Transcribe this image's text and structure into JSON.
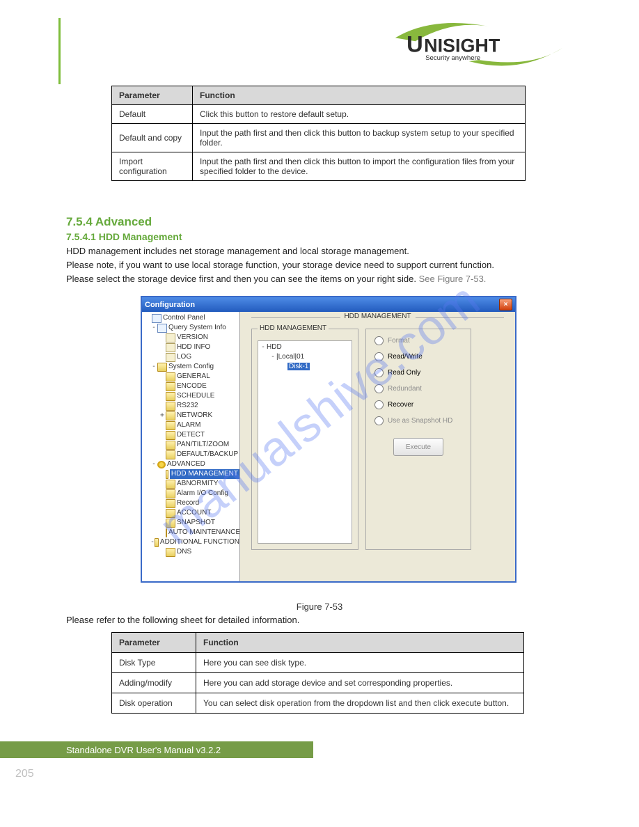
{
  "logo": {
    "brand": "UNISIGHT",
    "tagline": "Security anywhere"
  },
  "table1": {
    "h1": "Parameter",
    "h2": "Function",
    "rows": [
      {
        "p": "Default",
        "f": "Click this button to restore default setup."
      },
      {
        "p": "Default and copy",
        "f": "Input the path first and then click this button to backup system setup to your specified folder."
      },
      {
        "p": "Import configuration",
        "f": "Input the path first and then click this button to import the configuration files from your specified folder to the device."
      }
    ]
  },
  "section_heading": "7.5.4 Advanced",
  "subhead": "7.5.4.1 HDD Management",
  "lead_in": "HDD management includes net storage management and local storage management.",
  "note": "Please note, if you want to use local storage function, your storage device need to support current function.",
  "select_text_a": "Please select the storage device first and then you can see the items on your right side.",
  "select_text_b": "See Figure 7-53.",
  "watermark": "manualshive.com",
  "figure": {
    "title": "Configuration",
    "root": "Control Panel",
    "panel_label": "HDD MANAGEMENT",
    "tree": {
      "query": "Query System Info",
      "version": "VERSION",
      "hdd_info": "HDD INFO",
      "log": "LOG",
      "sysconfig": "System Config",
      "general": "GENERAL",
      "encode": "ENCODE",
      "schedule": "SCHEDULE",
      "rs232": "RS232",
      "network": "NETWORK",
      "alarm": "ALARM",
      "detect": "DETECT",
      "ptz": "PAN/TILT/ZOOM",
      "default": "DEFAULT/BACKUP",
      "advanced": "ADVANCED",
      "hdd_mgmt": "HDD MANAGEMENT",
      "abnormity": "ABNORMITY",
      "alarm_io": "Alarm I/O Config",
      "record": "Record",
      "account": "ACCOUNT",
      "snapshot": "SNAPSHOT",
      "auto_maint": "AUTO MAINTENANCE",
      "addfunc": "ADDITIONAL FUNCTION",
      "dns": "DNS"
    },
    "hdd_group_label": "HDD MANAGEMENT",
    "hdd_tree": {
      "root": "HDD",
      "local": "|Local|01",
      "disk": "Disk-1"
    },
    "options": {
      "format": "Format",
      "read_write": "Read/Write",
      "read_only": "Read Only",
      "redundant": "Redundant",
      "recover": "Recover",
      "snapshot_hd": "Use as Snapshot HD"
    },
    "execute": "Execute"
  },
  "figure_caption": "Figure 7-53",
  "para_after": "Please refer to the following sheet for detailed information.",
  "table2": {
    "h1": "Parameter",
    "h2": "Function",
    "rows": [
      {
        "p": "Disk Type",
        "f": "Here you can see disk type."
      },
      {
        "p": "Adding/modify",
        "f": "Here you can add storage device and set corresponding properties."
      },
      {
        "p": "Disk operation",
        "f": "You can select disk operation from the dropdown list and then click execute button."
      }
    ]
  },
  "footer": "Standalone DVR User's Manual v3.2.2",
  "page_num": "205"
}
